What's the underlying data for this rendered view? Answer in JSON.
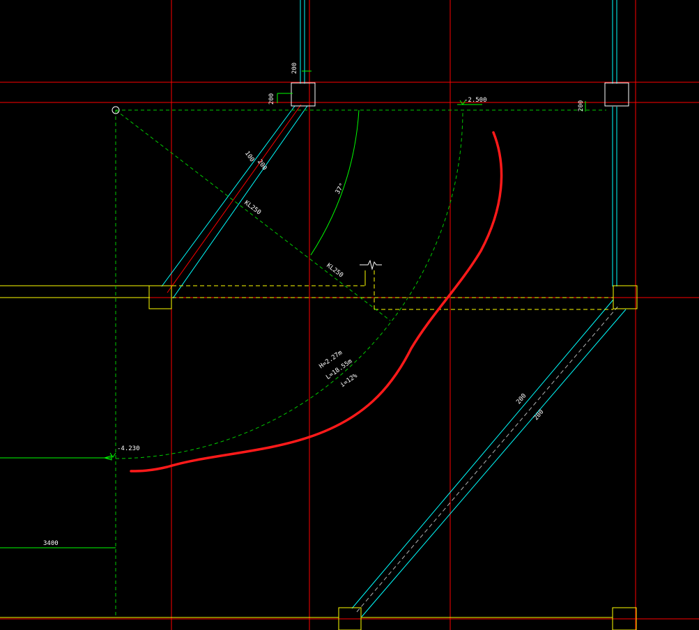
{
  "colors": {
    "background": "#000000",
    "grid_axis": "#ff0000",
    "wall_cyan": "#00ffff",
    "wall_yellow": "#ffff00",
    "dashed_green": "#00cc00",
    "dim_green": "#00ff00",
    "white": "#ffffff",
    "markup_red": "#ff1a1a"
  },
  "dimensions": {
    "dim_200_top": "200",
    "dim_200_left": "200",
    "dim_200_right": "200",
    "dim_100": "100",
    "dim_200_diag": "200",
    "dim_200_lower_a": "200",
    "dim_200_lower_b": "200",
    "dim_3400": "3400"
  },
  "beams": {
    "beam_upper": "KL250",
    "beam_lower": "KL250"
  },
  "elevations": {
    "elev_top": "-2.500",
    "elev_left": "-4.230"
  },
  "annotations": {
    "angle": "37°",
    "ramp_height": "H=2.27m",
    "ramp_length": "L=18.55m",
    "ramp_slope": "i=12%"
  },
  "icons": {
    "break_symbol": "break-line-icon",
    "center_point": "circle-center-icon"
  }
}
